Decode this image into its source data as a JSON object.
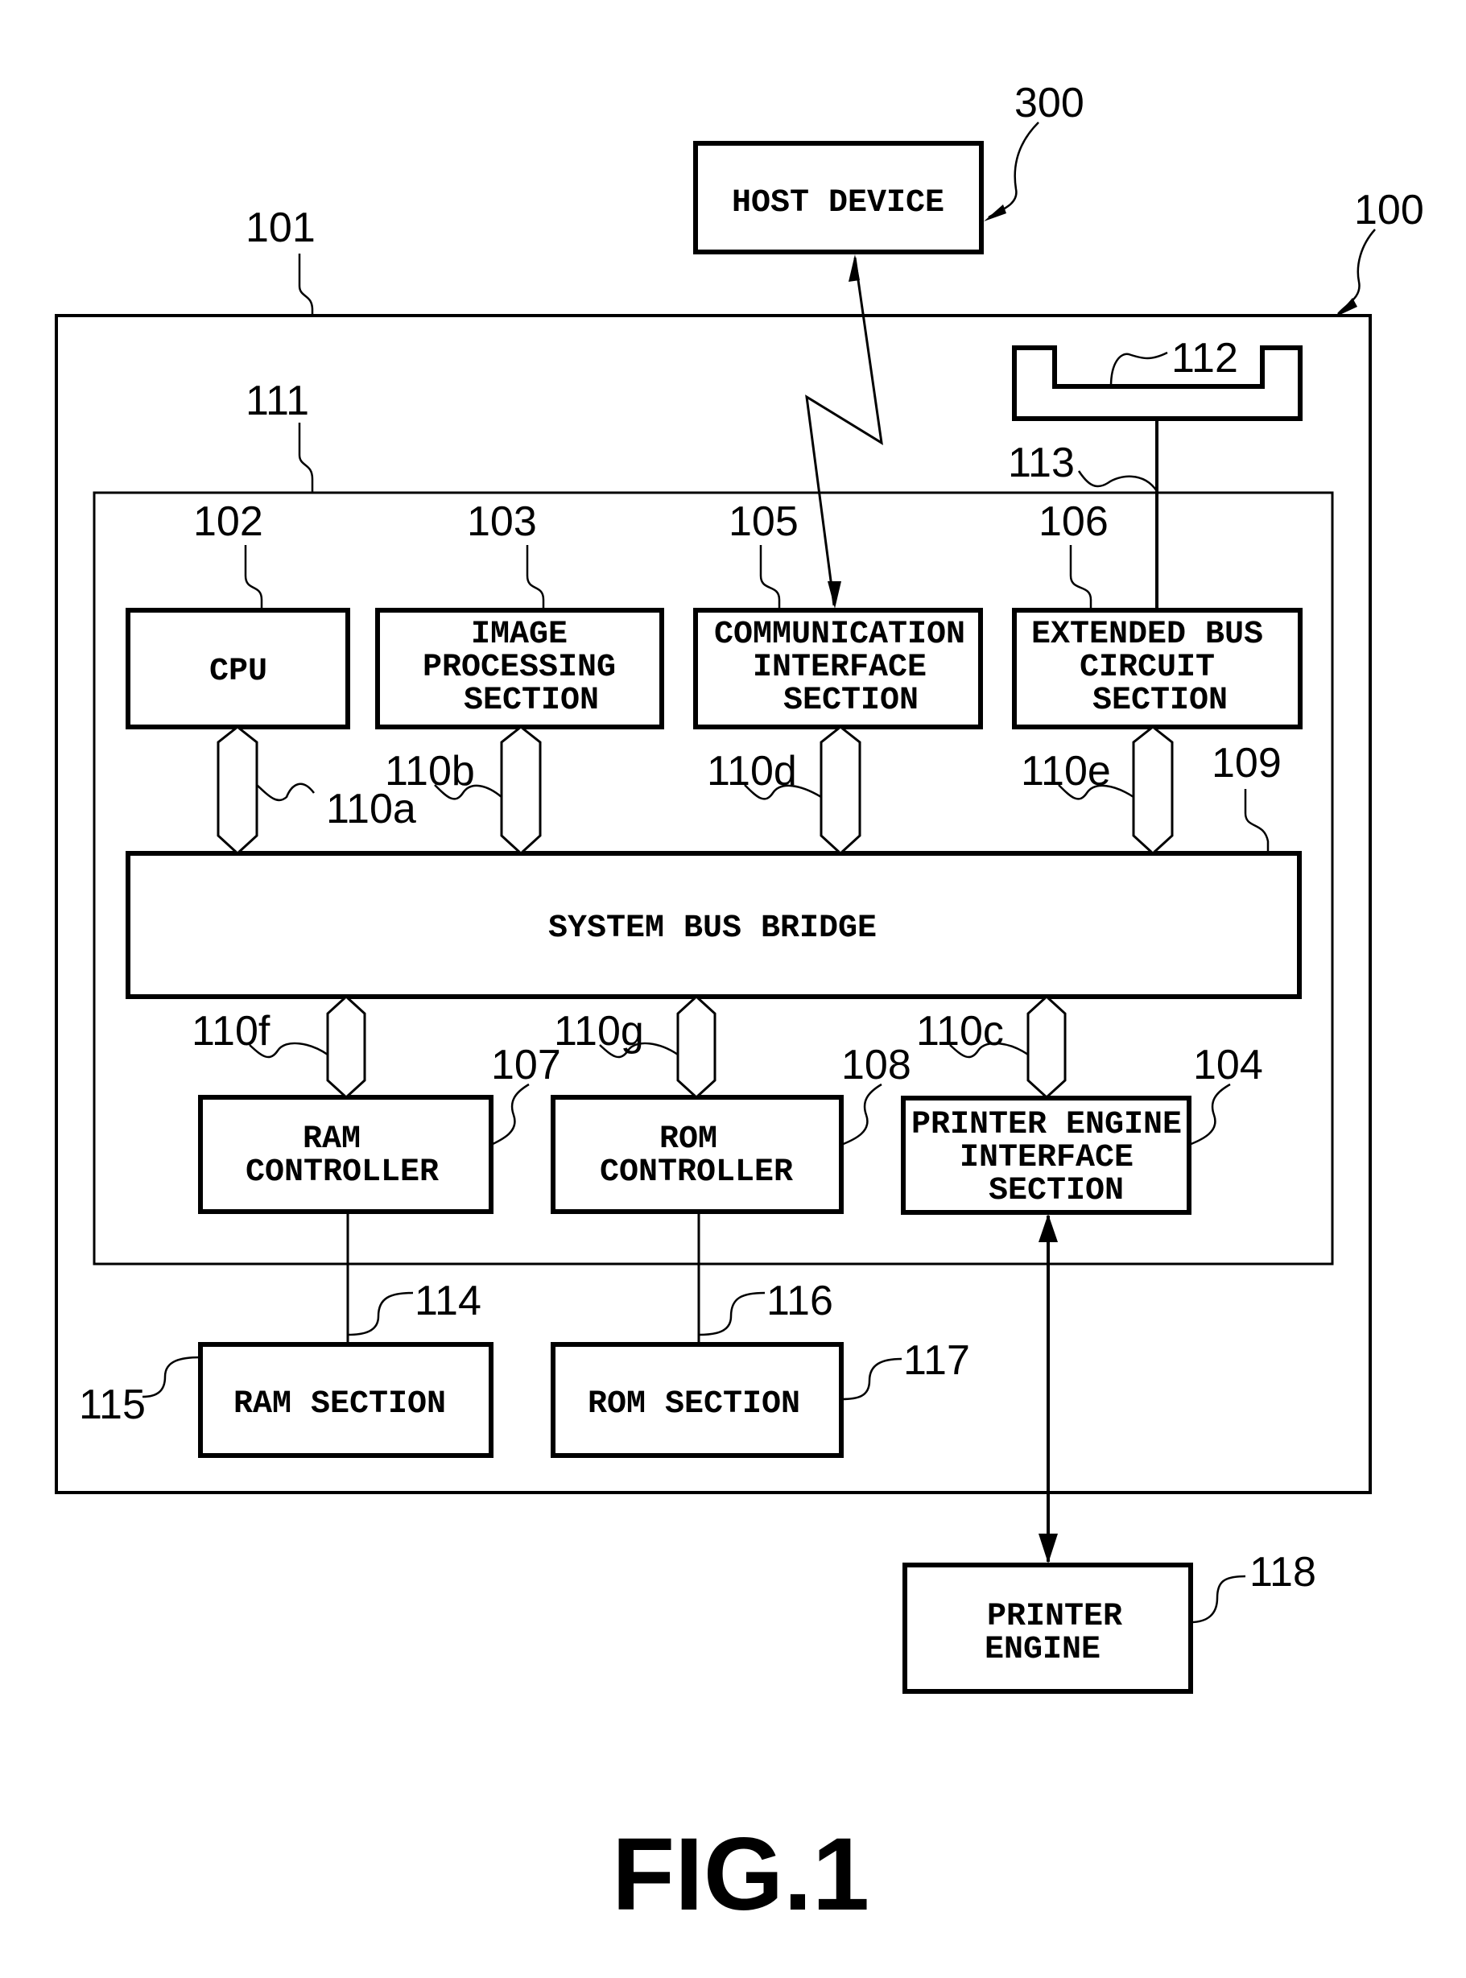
{
  "figure": {
    "caption": "FIG.1",
    "references": {
      "printer": "100",
      "controller_board": "101",
      "asic": "111",
      "cpu": "102",
      "image_processing": "103",
      "printer_engine_if": "104",
      "communication_if": "105",
      "extended_bus": "106",
      "ram_controller": "107",
      "rom_controller": "108",
      "system_bus_bridge": "109",
      "bus_a": "110a",
      "bus_b": "110b",
      "bus_c": "110c",
      "bus_d": "110d",
      "bus_e": "110e",
      "bus_f": "110f",
      "bus_g": "110g",
      "expansion_slot": "112",
      "extended_bus_line": "113",
      "ram_line": "114",
      "ram_section": "115",
      "rom_line": "116",
      "rom_section": "117",
      "printer_engine": "118",
      "host_device": "300"
    },
    "blocks": {
      "host_device": [
        "HOST DEVICE"
      ],
      "cpu": [
        "CPU"
      ],
      "image_processing": [
        "IMAGE",
        "PROCESSING",
        "SECTION"
      ],
      "communication_if": [
        "COMMUNICATION",
        "INTERFACE",
        "SECTION"
      ],
      "extended_bus": [
        "EXTENDED BUS",
        "CIRCUIT",
        "SECTION"
      ],
      "system_bus_bridge": [
        "SYSTEM BUS BRIDGE"
      ],
      "ram_controller": [
        "RAM",
        "CONTROLLER"
      ],
      "rom_controller": [
        "ROM",
        "CONTROLLER"
      ],
      "printer_engine_if": [
        "PRINTER ENGINE",
        "INTERFACE",
        "SECTION"
      ],
      "ram_section": [
        "RAM SECTION"
      ],
      "rom_section": [
        "ROM SECTION"
      ],
      "printer_engine": [
        "PRINTER",
        "ENGINE"
      ]
    }
  }
}
